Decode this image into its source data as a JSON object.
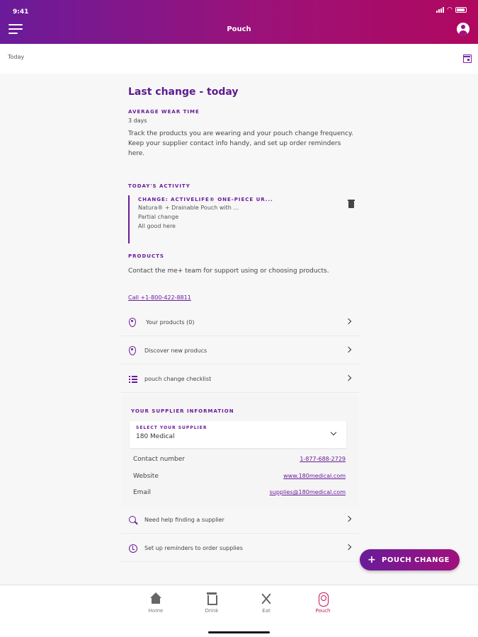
{
  "status_bar": {
    "time": "9:41"
  },
  "header": {
    "title": "Pouch"
  },
  "date_bar": {
    "label": "Today"
  },
  "last_change": {
    "title": "Last change - today",
    "wear_heading": "AVERAGE WEAR TIME",
    "wear_value": "3 days",
    "intro": "Track the products you are wearing and your pouch change frequency. Keep your supplier contact info handy, and set up order reminders here."
  },
  "activity": {
    "heading": "TODAY'S ACTIVITY",
    "entry": {
      "type": "CHANGE: ACTIVELIFE® ONE-PIECE UR...",
      "product": "Natura® + Drainable Pouch with ...",
      "kind": "Partial change",
      "note": "All good here"
    }
  },
  "products": {
    "heading": "PRODUCTS",
    "text": "Contact the me+ team for support using or choosing products.",
    "call_link": "Call +1-800-422-8811",
    "rows": [
      {
        "label": "Your products (0)",
        "icon": "location-pin-icon"
      },
      {
        "label": "Discover new producs",
        "icon": "location-pin-icon"
      },
      {
        "label": "pouch change checklist",
        "icon": "checklist-icon"
      }
    ]
  },
  "supplier": {
    "heading": "YOUR SUPPLIER INFORMATION",
    "select_label": "SELECT YOUR SUPPLIER",
    "select_value": "180 Medical",
    "contact": {
      "label": "Contact number",
      "value": "1-877-688-2729"
    },
    "website": {
      "label": "Website",
      "value": "www.180medical.com"
    },
    "email": {
      "label": "Email",
      "value": "supplies@180medical.com"
    },
    "rows": [
      {
        "label": "Need help finding a supplier",
        "icon": "search-icon"
      },
      {
        "label": "Set up reminders to order supplies",
        "icon": "alarm-clock-icon"
      }
    ]
  },
  "fab": {
    "plus": "+",
    "label": "POUCH CHANGE"
  },
  "tabs": [
    {
      "label": "Home",
      "icon": "home-icon"
    },
    {
      "label": "Drink",
      "icon": "cup-icon"
    },
    {
      "label": "Eat",
      "icon": "fork-knife-icon"
    },
    {
      "label": "Pouch",
      "icon": "pouch-icon",
      "active": true
    }
  ],
  "colors": {
    "brand_purple": "#6a1b9a",
    "brand_magenta": "#b0085f",
    "active_tab": "#c2185b"
  }
}
